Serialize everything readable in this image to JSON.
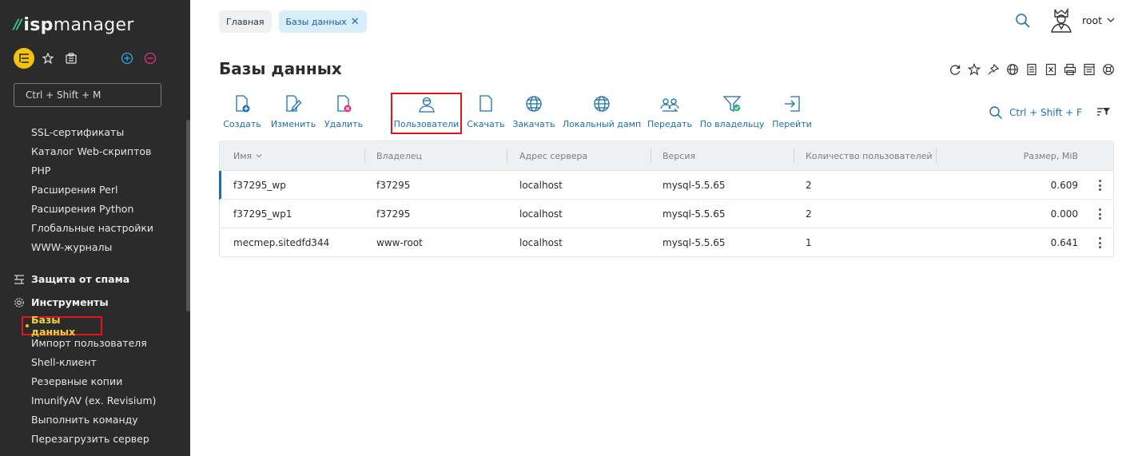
{
  "app": {
    "logo_prefix": "isp",
    "logo_suffix": "manager"
  },
  "sidebar": {
    "search_placeholder": "Ctrl + Shift + M",
    "items_top": [
      {
        "label": "SSL-сертификаты"
      },
      {
        "label": "Каталог Web-скриптов"
      },
      {
        "label": "PHP"
      },
      {
        "label": "Расширения Perl"
      },
      {
        "label": "Расширения Python"
      },
      {
        "label": "Глобальные настройки"
      },
      {
        "label": "WWW-журналы"
      }
    ],
    "group_spam": {
      "label": "Защита от спама",
      "icon": "spam-filter-icon"
    },
    "group_tools": {
      "label": "Инструменты",
      "icon": "gear-icon"
    },
    "active_item": {
      "label": "Базы данных"
    },
    "items_tools": [
      {
        "label": "Импорт пользователя"
      },
      {
        "label": "Shell-клиент"
      },
      {
        "label": "Резервные копии"
      },
      {
        "label": "ImunifyAV (ex. Revisium)"
      },
      {
        "label": "Выполнить команду"
      },
      {
        "label": "Перезагрузить сервер"
      }
    ]
  },
  "header": {
    "breadcrumbs": [
      {
        "label": "Главная"
      },
      {
        "label": "Базы данных"
      }
    ],
    "user": "root"
  },
  "page": {
    "title": "Базы данных"
  },
  "toolbar": {
    "buttons": [
      {
        "label": "Создать",
        "icon": "create-icon"
      },
      {
        "label": "Изменить",
        "icon": "edit-icon"
      },
      {
        "label": "Удалить",
        "icon": "delete-icon"
      },
      {
        "label": "Пользователи",
        "icon": "users-icon"
      },
      {
        "label": "Скачать",
        "icon": "download-icon"
      },
      {
        "label": "Закачать",
        "icon": "upload-icon"
      },
      {
        "label": "Локальный дамп",
        "icon": "local-dump-icon"
      },
      {
        "label": "Передать",
        "icon": "transfer-icon"
      },
      {
        "label": "По владельцу",
        "icon": "filter-owner-icon"
      },
      {
        "label": "Перейти",
        "icon": "go-icon"
      }
    ],
    "search_hint": "Ctrl + Shift + F"
  },
  "table": {
    "columns": [
      "Имя",
      "Владелец",
      "Адрес сервера",
      "Версия",
      "Количество пользователей",
      "Размер, MiB"
    ],
    "rows": [
      {
        "name": "f37295_wp",
        "owner": "f37295",
        "server": "localhost",
        "version": "mysql-5.5.65",
        "users": "2",
        "size": "0.609"
      },
      {
        "name": "f37295_wp1",
        "owner": "f37295",
        "server": "localhost",
        "version": "mysql-5.5.65",
        "users": "2",
        "size": "0.000"
      },
      {
        "name": "mecmep.sitedfd344",
        "owner": "www-root",
        "server": "localhost",
        "version": "mysql-5.5.65",
        "users": "1",
        "size": "0.641"
      }
    ]
  },
  "colors": {
    "sidebar_bg": "#2b2b2b",
    "accent_blue": "#1a6fb0",
    "accent_yellow": "#f2c40a",
    "highlight_red": "#e0141e",
    "logo_green": "#2fd28a"
  }
}
